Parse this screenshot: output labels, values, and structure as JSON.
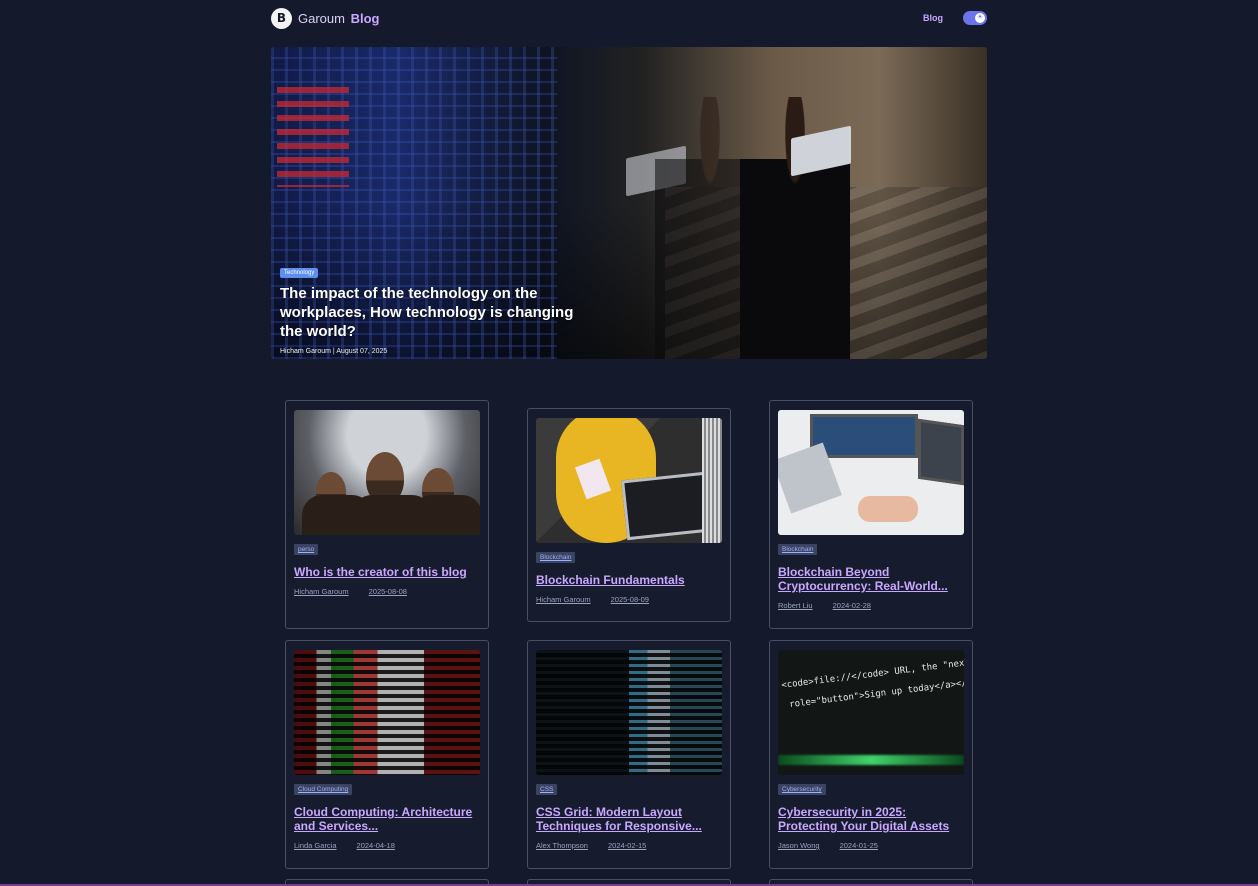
{
  "header": {
    "logo_glyph": "B",
    "brand_name": "Garoum",
    "brand_highlight": "Blog",
    "nav_blog": "Blog",
    "theme_toggle_glyph": "☀",
    "accent_color": "#c9a8ff",
    "toggle_color": "#6c74ea"
  },
  "hero": {
    "tag": "Technology",
    "title": "The impact of the technology on the workplaces, How technology is changing the world?",
    "author": "Hicham Garoum",
    "separator": "|",
    "date": "August 07, 2025"
  },
  "posts": [
    {
      "tag": "perso",
      "title": "Who is the creator of this blog",
      "author": "Hicham Garoum",
      "date": "2025-08-08",
      "image": "three-men-portrait"
    },
    {
      "tag": "Blockchain",
      "title": "Blockchain Fundamentals",
      "author": "Hicham Garoum",
      "date": "2025-08-09",
      "image": "laptop-yellow-chair"
    },
    {
      "tag": "Blockchain",
      "title": "Blockchain Beyond Cryptocurrency: Real-World...",
      "author": "Robert Liu",
      "date": "2024-02-28",
      "image": "desk-monitors"
    },
    {
      "tag": "Cloud Computing",
      "title": "Cloud Computing: Architecture and Services...",
      "author": "Linda Garcia",
      "date": "2024-04-18",
      "image": "code-screen-red"
    },
    {
      "tag": "CSS",
      "title": "CSS Grid: Modern Layout Techniques for Responsive...",
      "author": "Alex Thompson",
      "date": "2024-02-15",
      "image": "code-screen-dark"
    },
    {
      "tag": "Cybersecurity",
      "title": "Cybersecurity in 2025: Protecting Your Digital Assets",
      "author": "Jason Wong",
      "date": "2024-01-25",
      "image": "code-screen-green"
    }
  ],
  "thumb_code_text": "<code>file://</code> URL, the \"next\"\n role=\"button\">Sign up today</a></"
}
